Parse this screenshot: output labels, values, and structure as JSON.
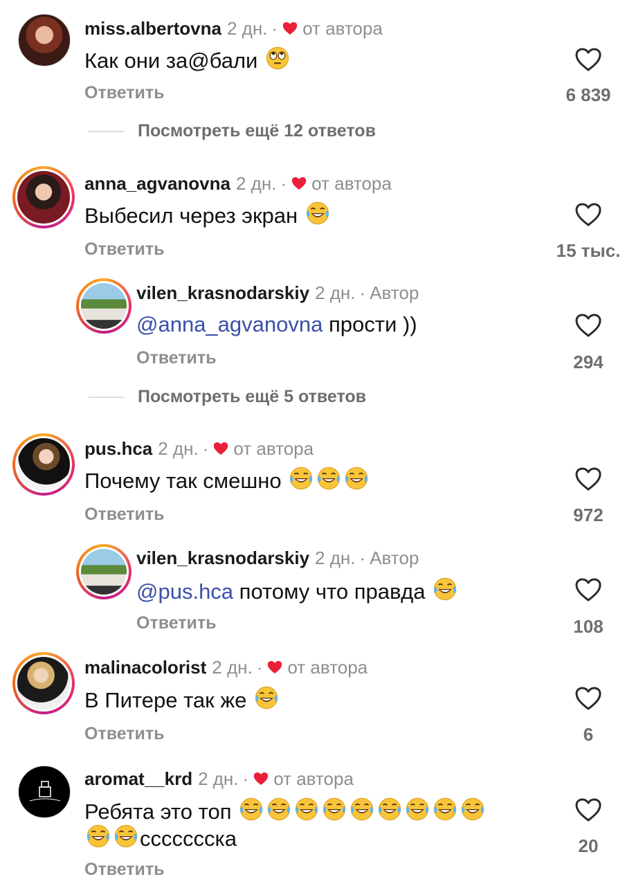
{
  "colors": {
    "accent_heart": "#ea1f3a",
    "mention": "#3a4fa8",
    "muted": "#8e8e8e"
  },
  "icons": {
    "like": "heart-outline-icon",
    "author_like": "heart-filled-icon",
    "emoji_laugh": "face-with-tears-of-joy-icon",
    "emoji_eyeroll": "face-with-rolling-eyes-icon"
  },
  "comments": [
    {
      "user": "miss.albertovna",
      "time": "2 дн.",
      "dot": "·",
      "by": "от автора",
      "text": "Как они за@бали",
      "reply": "Ответить",
      "likes": "6 839"
    },
    {
      "user": "anna_agvanovna",
      "time": "2 дн.",
      "dot": "·",
      "by": "от автора",
      "text": "Выбесил через экран",
      "reply": "Ответить",
      "likes": "15 тыс."
    },
    {
      "user": "vilen_krasnodarskiy",
      "time": "2 дн.",
      "dot": "·",
      "by": "Автор",
      "mention": "@anna_agvanovna",
      "text": " прости ))",
      "reply": "Ответить",
      "likes": "294"
    },
    {
      "user": "pus.hca",
      "time": "2 дн.",
      "dot": "·",
      "by": "от автора",
      "text": "Почему так смешно",
      "reply": "Ответить",
      "likes": "972"
    },
    {
      "user": "vilen_krasnodarskiy",
      "time": "2 дн.",
      "dot": "·",
      "by": "Автор",
      "mention": "@pus.hca",
      "text": " потому что правда",
      "reply": "Ответить",
      "likes": "108"
    },
    {
      "user": "malinacolorist",
      "time": "2 дн.",
      "dot": "·",
      "by": "от автора",
      "text": "В Питере так же",
      "reply": "Ответить",
      "likes": "6"
    },
    {
      "user": "aromat__krd",
      "time": "2 дн.",
      "dot": "·",
      "by": "от автора",
      "text": "Ребята это топ",
      "text2": "ссссссска",
      "reply": "Ответить",
      "likes": "20"
    }
  ],
  "view_more": [
    {
      "label": "Посмотреть ещё 12 ответов"
    },
    {
      "label": "Посмотреть ещё 5 ответов"
    }
  ]
}
